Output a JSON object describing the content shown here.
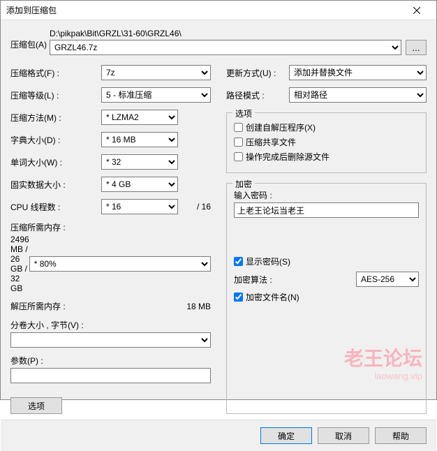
{
  "title": "添加到压缩包",
  "archive": {
    "label": "压缩包(A)",
    "path": "D:\\pikpak\\Bit\\GRZL\\31-60\\GRZL46\\",
    "filename": "GRZL46.7z",
    "browse": "..."
  },
  "left": {
    "format": {
      "label": "压缩格式(F) :",
      "value": "7z"
    },
    "level": {
      "label": "压缩等级(L) :",
      "value": "5 - 标准压缩"
    },
    "method": {
      "label": "压缩方法(M) :",
      "value": "* LZMA2"
    },
    "dict": {
      "label": "字典大小(D) :",
      "value": "* 16 MB"
    },
    "word": {
      "label": "单词大小(W) :",
      "value": "* 32"
    },
    "solid": {
      "label": "固实数据大小 :",
      "value": "* 4 GB"
    },
    "cpu": {
      "label": "CPU 线程数 :",
      "value": "* 16",
      "total": "/ 16"
    },
    "compress_mem": {
      "label": "压缩所需内存 :",
      "value": "2496 MB / 26 GB / 32 GB",
      "pct": "* 80%"
    },
    "decompress_mem": {
      "label": "解压所需内存 :",
      "value": "18 MB"
    },
    "split": {
      "label": "分卷大小 , 字节(V) :"
    },
    "params": {
      "label": "参数(P) :"
    },
    "options_btn": "选项"
  },
  "right": {
    "update": {
      "label": "更新方式(U) :",
      "value": "添加并替换文件"
    },
    "pathmode": {
      "label": "路径模式 :",
      "value": "相对路径"
    },
    "options": {
      "legend": "选项",
      "sfx": "创建自解压程序(X)",
      "shared": "压缩共享文件",
      "delete": "操作完成后删除源文件"
    },
    "encryption": {
      "legend": "加密",
      "password_label": "输入密码 :",
      "password_value": "上老王论坛当老王",
      "show": "显示密码(S)",
      "algo_label": "加密算法 :",
      "algo_value": "AES-256",
      "encrypt_names": "加密文件名(N)"
    }
  },
  "footer": {
    "ok": "确定",
    "cancel": "取消",
    "help": "帮助"
  },
  "watermark": {
    "main": "老王论坛",
    "sub": "laowang.vip"
  }
}
